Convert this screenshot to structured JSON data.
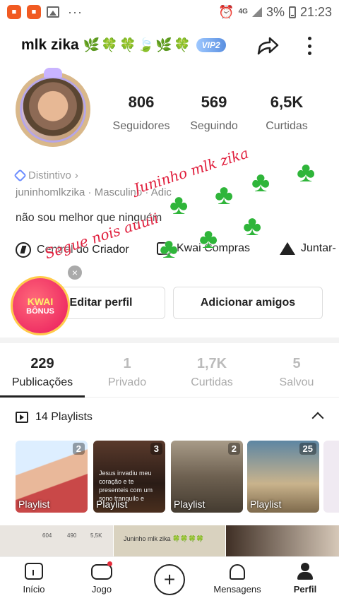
{
  "status_bar": {
    "app_icon_1": "app-notification-icon",
    "app_icon_2": "app-notification-icon",
    "dots": "···",
    "network": "4G",
    "battery_percent": "3%",
    "time": "21:23"
  },
  "header": {
    "username": "mlk zika",
    "decoration": "🌿🍀🍀🍃🌿🍀",
    "vip_badge": "VIP2"
  },
  "stats": [
    {
      "value": "806",
      "label": "Seguidores"
    },
    {
      "value": "569",
      "label": "Seguindo"
    },
    {
      "value": "6,5K",
      "label": "Curtidas"
    }
  ],
  "profile": {
    "distintivo": "Distintivo",
    "handle_line": "juninhomlkzika · Masculino · Adic",
    "bio": "não sou melhor que ninguém"
  },
  "actions": [
    {
      "label": "Central do Criador",
      "icon": "bolt-icon"
    },
    {
      "label": "Kwai Compras",
      "icon": "bag-icon"
    },
    {
      "label": "Juntar-",
      "icon": "house-icon"
    }
  ],
  "buttons": {
    "edit": "Editar perfil",
    "add_friends": "Adicionar amigos",
    "close": "×"
  },
  "bonus": {
    "line1": "KWAI",
    "line2": "BÔNUS"
  },
  "overlay": {
    "text1": "Juninho mlk zika",
    "text2": "Segue nois auuii"
  },
  "tabs": [
    {
      "count": "229",
      "label": "Publicações",
      "active": true
    },
    {
      "count": "1",
      "label": "Privado",
      "active": false
    },
    {
      "count": "1,7K",
      "label": "Curtidas",
      "active": false
    },
    {
      "count": "5",
      "label": "Salvou",
      "active": false
    }
  ],
  "playlists": {
    "header": "14 Playlists",
    "cards": [
      {
        "count": "2",
        "label": "Playlist"
      },
      {
        "count": "3",
        "label": "Playlist",
        "overtext": "Jesus invadiu meu coração e te presenteis com um sono tranquilo e"
      },
      {
        "count": "2",
        "label": "Playlist"
      },
      {
        "count": "25",
        "label": "Playlist"
      }
    ]
  },
  "thumbs": {
    "stats_mini": [
      "604",
      "490",
      "5,5K"
    ],
    "caption": "Juninho mlk zika 🍀🍀🍀🍀"
  },
  "nav": [
    {
      "label": "Início",
      "icon": "home-icon",
      "active": false
    },
    {
      "label": "Jogo",
      "icon": "gamepad-icon",
      "active": false
    },
    {
      "label": "",
      "icon": "plus-icon",
      "active": false
    },
    {
      "label": "Mensagens",
      "icon": "bell-icon",
      "active": false
    },
    {
      "label": "Perfil",
      "icon": "person-icon",
      "active": true
    }
  ],
  "colors": {
    "accent_red": "#e01e3c",
    "vip_blue": "#5a8fe0",
    "clover_green": "#2fb53a"
  }
}
